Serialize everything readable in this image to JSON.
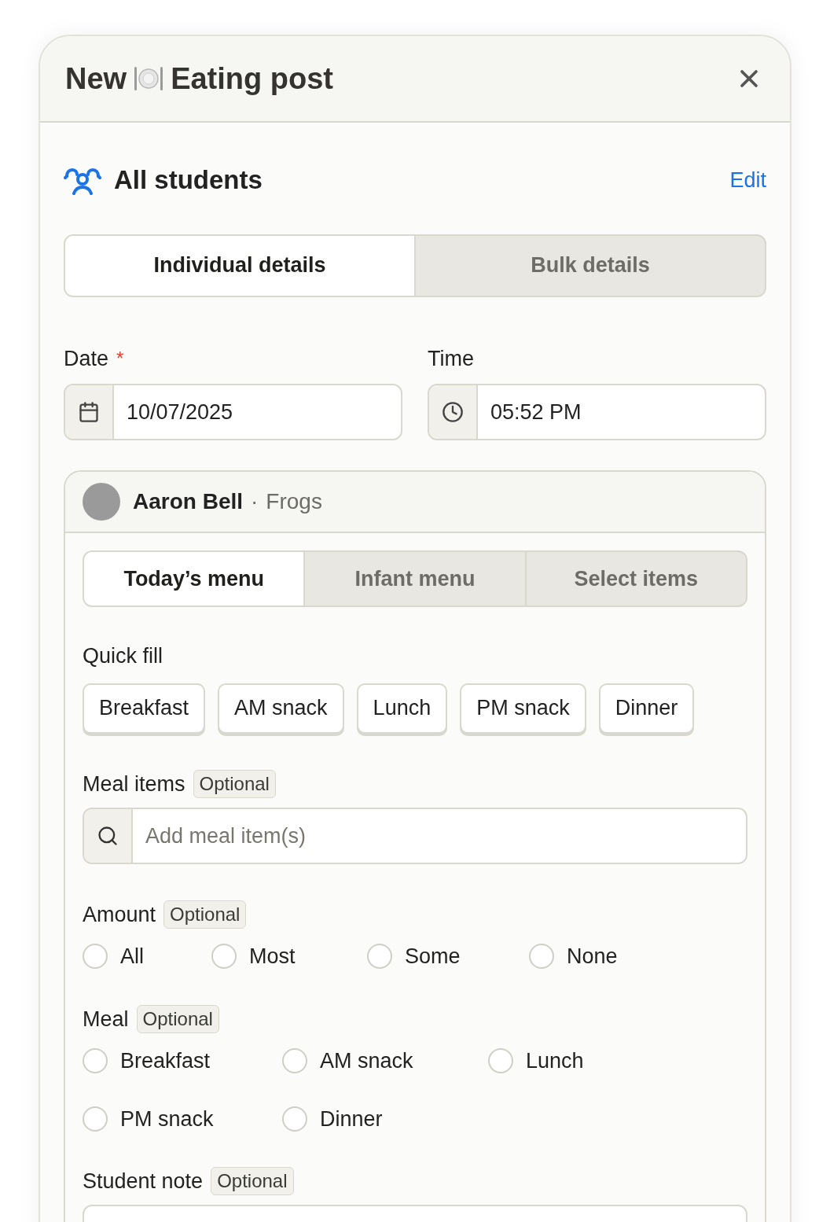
{
  "dialog": {
    "title_before": "New",
    "title_after": "Eating post"
  },
  "audience": {
    "label": "All students",
    "edit": "Edit"
  },
  "detail_tabs": [
    {
      "label": "Individual details",
      "selected": true
    },
    {
      "label": "Bulk details",
      "selected": false
    }
  ],
  "date": {
    "label": "Date",
    "required": true,
    "required_mark": "*",
    "value": "10/07/2025"
  },
  "time": {
    "label": "Time",
    "value": "05:52 PM"
  },
  "student": {
    "name": "Aaron Bell",
    "separator": "·",
    "group": "Frogs"
  },
  "menu_tabs": [
    {
      "label": "Today’s menu",
      "selected": true
    },
    {
      "label": "Infant menu",
      "selected": false
    },
    {
      "label": "Select items",
      "selected": false
    }
  ],
  "quick_fill": {
    "label": "Quick fill",
    "buttons": [
      "Breakfast",
      "AM snack",
      "Lunch",
      "PM snack",
      "Dinner"
    ]
  },
  "meal_items": {
    "label": "Meal items",
    "badge": "Optional",
    "placeholder": "Add meal item(s)"
  },
  "amount": {
    "label": "Amount",
    "badge": "Optional",
    "options": [
      {
        "label": "All",
        "selected": false
      },
      {
        "label": "Most",
        "selected": false
      },
      {
        "label": "Some",
        "selected": false
      },
      {
        "label": "None",
        "selected": false
      }
    ]
  },
  "meal": {
    "label": "Meal",
    "badge": "Optional",
    "options": [
      {
        "label": "Breakfast",
        "selected": false
      },
      {
        "label": "AM snack",
        "selected": false
      },
      {
        "label": "Lunch",
        "selected": false
      },
      {
        "label": "PM snack",
        "selected": false
      },
      {
        "label": "Dinner",
        "selected": false
      }
    ]
  },
  "student_note": {
    "label": "Student note",
    "badge": "Optional"
  }
}
